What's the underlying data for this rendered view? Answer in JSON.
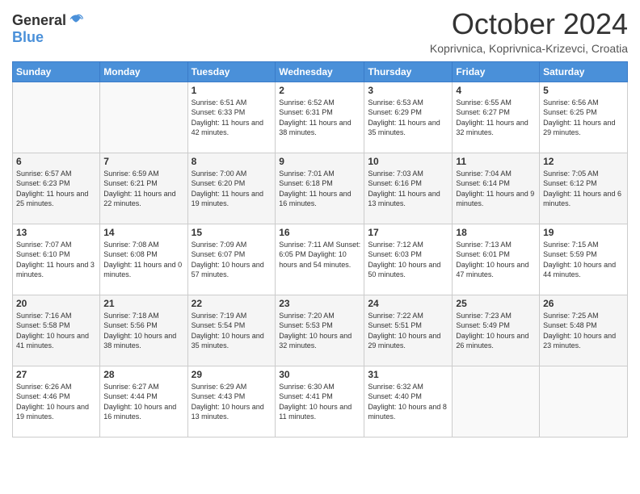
{
  "logo": {
    "general": "General",
    "blue": "Blue"
  },
  "title": "October 2024",
  "location": "Koprivnica, Koprivnica-Krizevci, Croatia",
  "weekdays": [
    "Sunday",
    "Monday",
    "Tuesday",
    "Wednesday",
    "Thursday",
    "Friday",
    "Saturday"
  ],
  "weeks": [
    [
      {
        "day": "",
        "info": ""
      },
      {
        "day": "",
        "info": ""
      },
      {
        "day": "1",
        "info": "Sunrise: 6:51 AM\nSunset: 6:33 PM\nDaylight: 11 hours and 42 minutes."
      },
      {
        "day": "2",
        "info": "Sunrise: 6:52 AM\nSunset: 6:31 PM\nDaylight: 11 hours and 38 minutes."
      },
      {
        "day": "3",
        "info": "Sunrise: 6:53 AM\nSunset: 6:29 PM\nDaylight: 11 hours and 35 minutes."
      },
      {
        "day": "4",
        "info": "Sunrise: 6:55 AM\nSunset: 6:27 PM\nDaylight: 11 hours and 32 minutes."
      },
      {
        "day": "5",
        "info": "Sunrise: 6:56 AM\nSunset: 6:25 PM\nDaylight: 11 hours and 29 minutes."
      }
    ],
    [
      {
        "day": "6",
        "info": "Sunrise: 6:57 AM\nSunset: 6:23 PM\nDaylight: 11 hours and 25 minutes."
      },
      {
        "day": "7",
        "info": "Sunrise: 6:59 AM\nSunset: 6:21 PM\nDaylight: 11 hours and 22 minutes."
      },
      {
        "day": "8",
        "info": "Sunrise: 7:00 AM\nSunset: 6:20 PM\nDaylight: 11 hours and 19 minutes."
      },
      {
        "day": "9",
        "info": "Sunrise: 7:01 AM\nSunset: 6:18 PM\nDaylight: 11 hours and 16 minutes."
      },
      {
        "day": "10",
        "info": "Sunrise: 7:03 AM\nSunset: 6:16 PM\nDaylight: 11 hours and 13 minutes."
      },
      {
        "day": "11",
        "info": "Sunrise: 7:04 AM\nSunset: 6:14 PM\nDaylight: 11 hours and 9 minutes."
      },
      {
        "day": "12",
        "info": "Sunrise: 7:05 AM\nSunset: 6:12 PM\nDaylight: 11 hours and 6 minutes."
      }
    ],
    [
      {
        "day": "13",
        "info": "Sunrise: 7:07 AM\nSunset: 6:10 PM\nDaylight: 11 hours and 3 minutes."
      },
      {
        "day": "14",
        "info": "Sunrise: 7:08 AM\nSunset: 6:08 PM\nDaylight: 11 hours and 0 minutes."
      },
      {
        "day": "15",
        "info": "Sunrise: 7:09 AM\nSunset: 6:07 PM\nDaylight: 10 hours and 57 minutes."
      },
      {
        "day": "16",
        "info": "Sunrise: 7:11 AM\nSunset: 6:05 PM\nDaylight: 10 hours and 54 minutes."
      },
      {
        "day": "17",
        "info": "Sunrise: 7:12 AM\nSunset: 6:03 PM\nDaylight: 10 hours and 50 minutes."
      },
      {
        "day": "18",
        "info": "Sunrise: 7:13 AM\nSunset: 6:01 PM\nDaylight: 10 hours and 47 minutes."
      },
      {
        "day": "19",
        "info": "Sunrise: 7:15 AM\nSunset: 5:59 PM\nDaylight: 10 hours and 44 minutes."
      }
    ],
    [
      {
        "day": "20",
        "info": "Sunrise: 7:16 AM\nSunset: 5:58 PM\nDaylight: 10 hours and 41 minutes."
      },
      {
        "day": "21",
        "info": "Sunrise: 7:18 AM\nSunset: 5:56 PM\nDaylight: 10 hours and 38 minutes."
      },
      {
        "day": "22",
        "info": "Sunrise: 7:19 AM\nSunset: 5:54 PM\nDaylight: 10 hours and 35 minutes."
      },
      {
        "day": "23",
        "info": "Sunrise: 7:20 AM\nSunset: 5:53 PM\nDaylight: 10 hours and 32 minutes."
      },
      {
        "day": "24",
        "info": "Sunrise: 7:22 AM\nSunset: 5:51 PM\nDaylight: 10 hours and 29 minutes."
      },
      {
        "day": "25",
        "info": "Sunrise: 7:23 AM\nSunset: 5:49 PM\nDaylight: 10 hours and 26 minutes."
      },
      {
        "day": "26",
        "info": "Sunrise: 7:25 AM\nSunset: 5:48 PM\nDaylight: 10 hours and 23 minutes."
      }
    ],
    [
      {
        "day": "27",
        "info": "Sunrise: 6:26 AM\nSunset: 4:46 PM\nDaylight: 10 hours and 19 minutes."
      },
      {
        "day": "28",
        "info": "Sunrise: 6:27 AM\nSunset: 4:44 PM\nDaylight: 10 hours and 16 minutes."
      },
      {
        "day": "29",
        "info": "Sunrise: 6:29 AM\nSunset: 4:43 PM\nDaylight: 10 hours and 13 minutes."
      },
      {
        "day": "30",
        "info": "Sunrise: 6:30 AM\nSunset: 4:41 PM\nDaylight: 10 hours and 11 minutes."
      },
      {
        "day": "31",
        "info": "Sunrise: 6:32 AM\nSunset: 4:40 PM\nDaylight: 10 hours and 8 minutes."
      },
      {
        "day": "",
        "info": ""
      },
      {
        "day": "",
        "info": ""
      }
    ]
  ]
}
